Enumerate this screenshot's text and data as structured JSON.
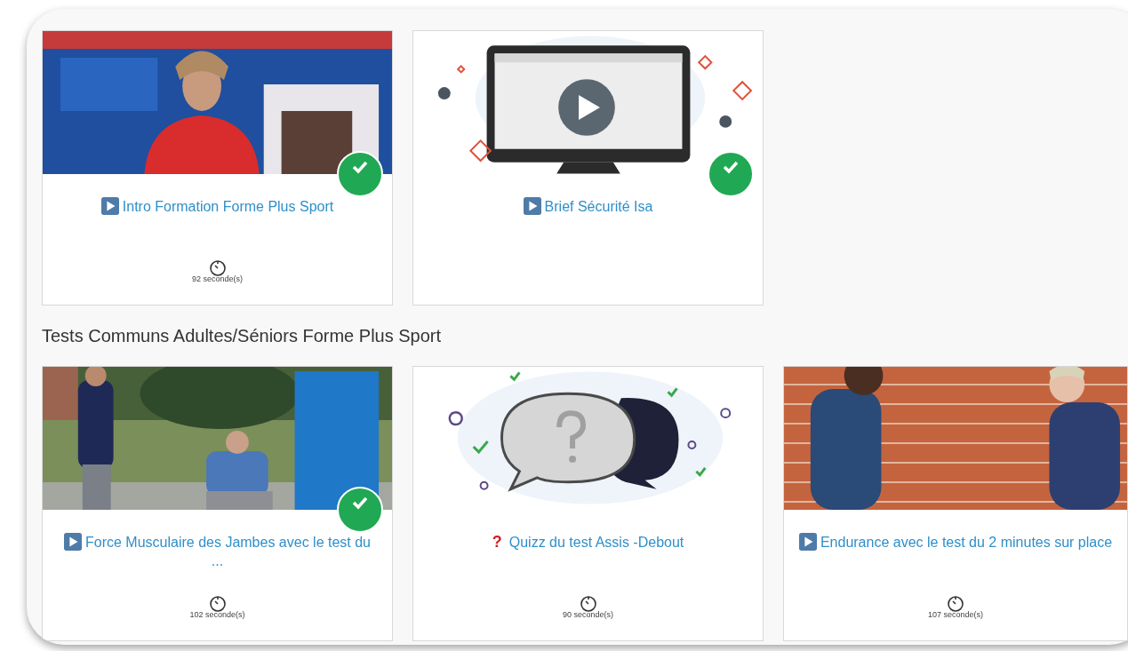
{
  "sections": [
    {
      "cards": [
        {
          "kind": "video",
          "title": "Intro Formation Forme Plus Sport",
          "duration": "92 seconde(s)",
          "completed": true
        },
        {
          "kind": "video",
          "media": {
            "kind": "monitor"
          },
          "title": "Brief Sécurité Isa",
          "completed": true
        }
      ]
    },
    {
      "heading": "Tests Communs Adultes/Séniors Forme Plus Sport",
      "cards": [
        {
          "kind": "video",
          "title": "Force Musculaire des Jambes avec le test du ...",
          "duration": "102 seconde(s)",
          "completed": true
        },
        {
          "kind": "quiz",
          "media": {
            "kind": "chat"
          },
          "icon_text": "?",
          "title": "Quizz du test Assis -Debout",
          "duration": "90 seconde(s)",
          "completed": false
        },
        {
          "kind": "video",
          "title": "Endurance avec le test du 2 minutes sur place",
          "duration": "107 seconde(s)",
          "completed": false
        }
      ]
    }
  ]
}
